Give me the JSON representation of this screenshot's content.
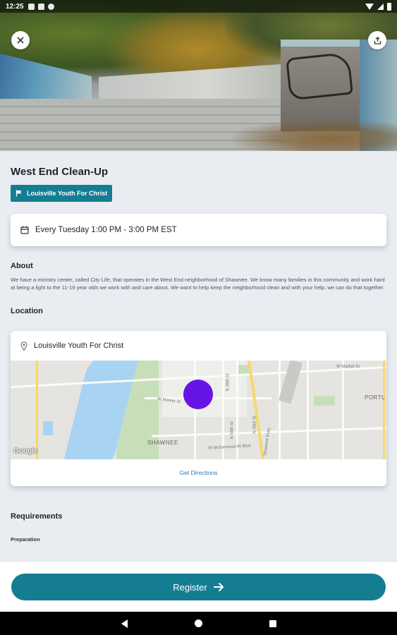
{
  "status_bar": {
    "time": "12:25"
  },
  "event": {
    "title": "West End Clean-Up",
    "organization": "Louisville Youth For Christ",
    "schedule": "Every Tuesday 1:00 PM - 3:00 PM EST"
  },
  "about": {
    "heading": "About",
    "text": "We have a ministry center, called City Life, that operates in the West End neighborhood of Shawnee.  We know many families in this community and work hard at being a light to the 11-19 year olds we work with and care about.  We want to help keep the neighborhood clean and with your help, we can do that together."
  },
  "location": {
    "heading": "Location",
    "name": "Louisville Youth For Christ",
    "directions_label": "Get Directions",
    "map": {
      "labels": [
        "SHAWNEE",
        "PORTL",
        "W Market St",
        "W Muhammad Ali Blvd",
        "N 35th St",
        "N 33rd St",
        "N 34th St",
        "Shawnee Expy",
        "W Market St"
      ],
      "attribution": "Google"
    }
  },
  "requirements": {
    "heading": "Requirements",
    "first_item": "Preparation"
  },
  "actions": {
    "register_label": "Register",
    "register_icon": "arrow-right-icon"
  },
  "colors": {
    "accent": "#147d92",
    "marker": "#6614e6",
    "link": "#2b7bb5"
  }
}
